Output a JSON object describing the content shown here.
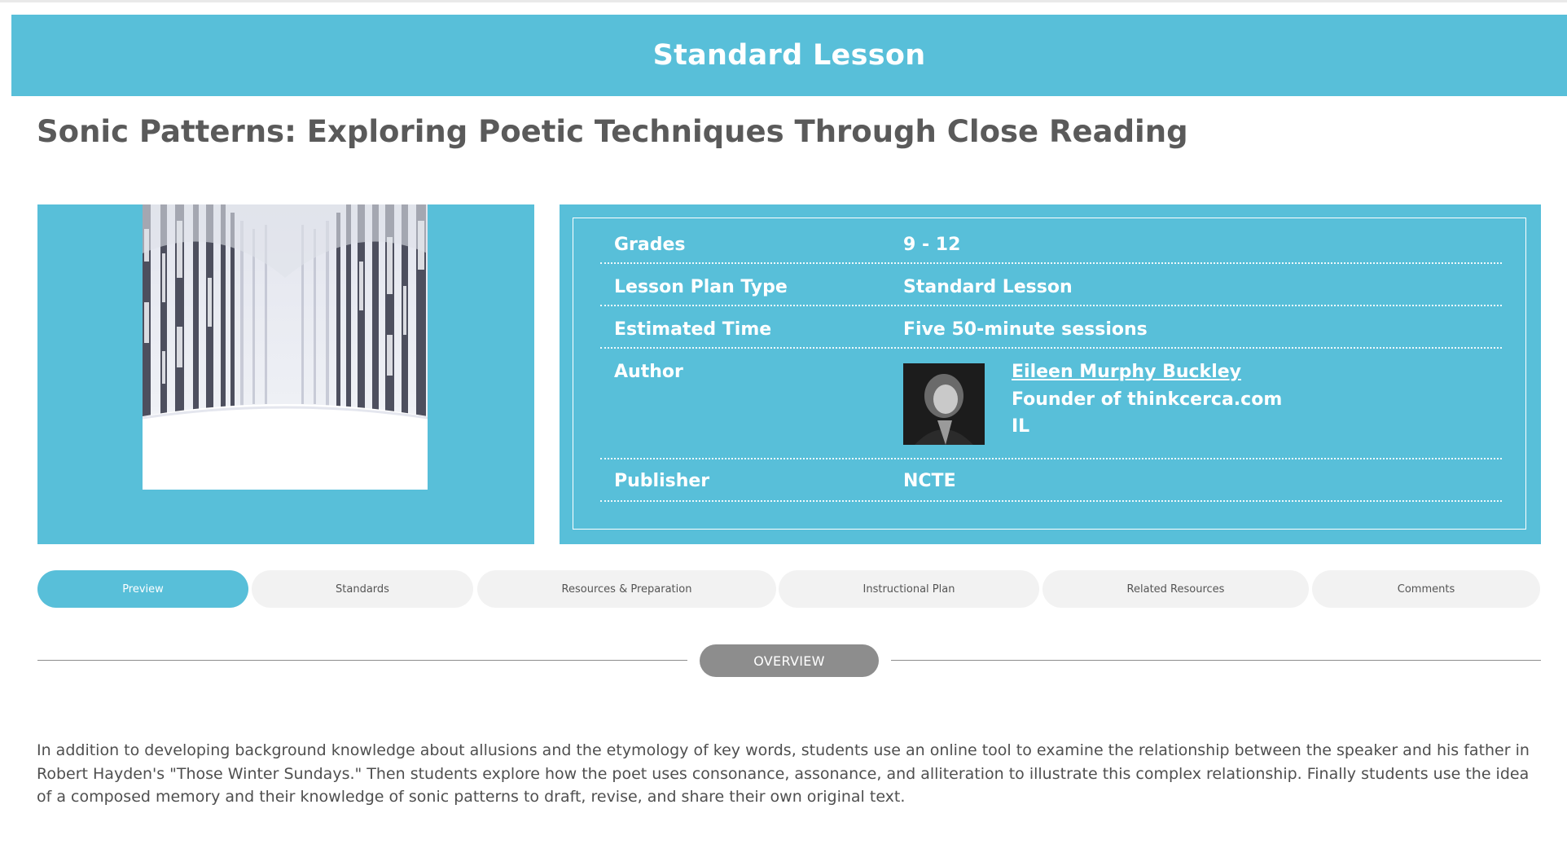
{
  "banner": {
    "title": "Standard Lesson"
  },
  "lesson": {
    "title": "Sonic Patterns: Exploring Poetic Techniques Through Close Reading"
  },
  "info": {
    "grades_label": "Grades",
    "grades_value": "9 - 12",
    "type_label": "Lesson Plan Type",
    "type_value": "Standard Lesson",
    "time_label": "Estimated Time",
    "time_value": "Five 50-minute sessions",
    "author_label": "Author",
    "author_name": "Eileen Murphy Buckley",
    "author_line2": "Founder of thinkcerca.com",
    "author_line3": "IL",
    "publisher_label": "Publisher",
    "publisher_value": "NCTE"
  },
  "tabs": [
    {
      "label": "Preview",
      "active": true
    },
    {
      "label": "Standards",
      "active": false
    },
    {
      "label": "Resources & Preparation",
      "active": false
    },
    {
      "label": "Instructional Plan",
      "active": false
    },
    {
      "label": "Related Resources",
      "active": false
    },
    {
      "label": "Comments",
      "active": false
    }
  ],
  "overview": {
    "heading": "OVERVIEW",
    "text": "In addition to developing background knowledge about allusions and the etymology of key words, students use an online tool to examine the relationship between the speaker and his father in Robert Hayden's \"Those Winter Sundays.\" Then students explore how the poet uses consonance, assonance, and alliteration to illustrate this complex relationship. Finally students use the idea of a composed memory and their knowledge of sonic patterns to draft, revise, and share their own original text."
  },
  "colors": {
    "accent": "#58bfd9",
    "tab_inactive": "#f2f2f2",
    "pill_gray": "#8d8d8d"
  }
}
